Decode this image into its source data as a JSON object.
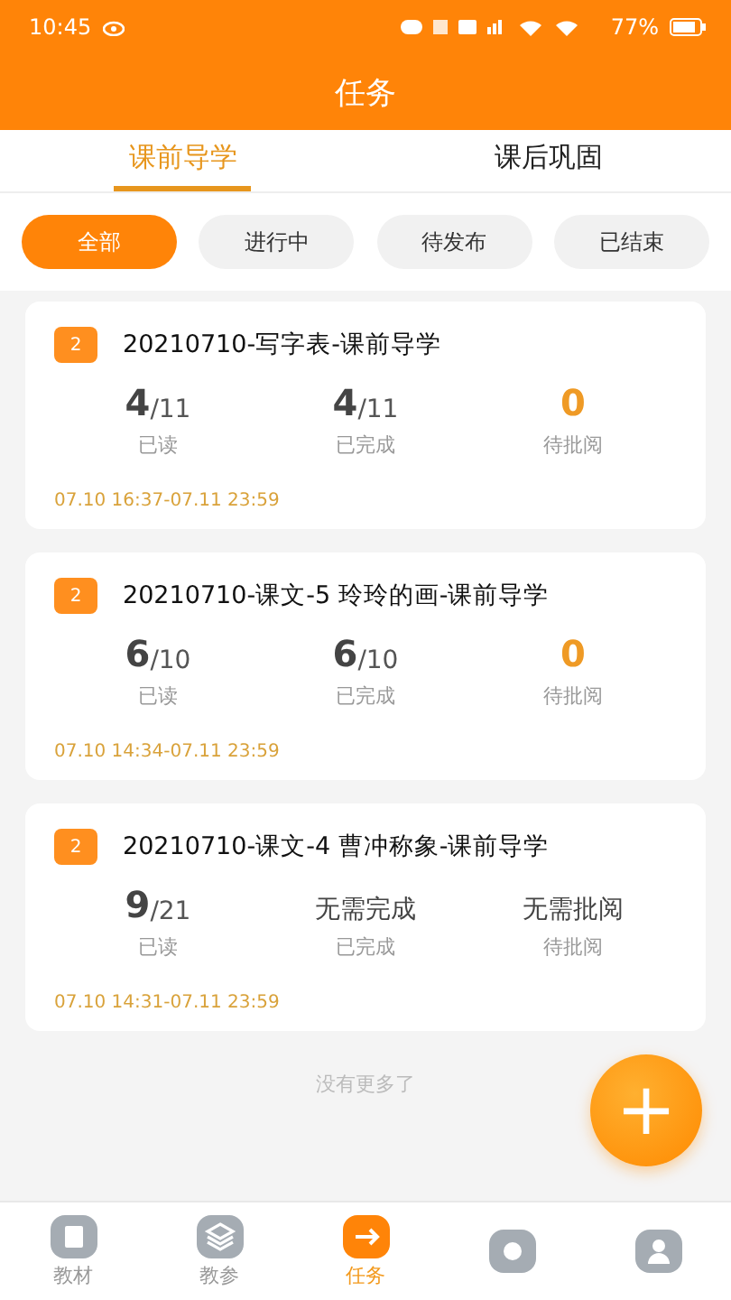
{
  "status_bar": {
    "time": "10:45",
    "battery": "77%"
  },
  "header": {
    "title": "任务"
  },
  "tabs": [
    {
      "label": "课前导学",
      "selected": true
    },
    {
      "label": "课后巩固",
      "selected": false
    }
  ],
  "filters": [
    {
      "label": "全部",
      "selected": true
    },
    {
      "label": "进行中",
      "selected": false
    },
    {
      "label": "待发布",
      "selected": false
    },
    {
      "label": "已结束",
      "selected": false
    }
  ],
  "tasks": [
    {
      "badge": "2",
      "title": "20210710-写字表-课前导学",
      "stats": [
        {
          "kind": "count",
          "value": "**4**/11",
          "label": "已读"
        },
        {
          "kind": "count",
          "value": "**4**/11",
          "label": "已完成"
        },
        {
          "kind": "pending",
          "value": "0",
          "label": "待批阅"
        }
      ],
      "time": "07.10  16:37-07.11  23:59"
    },
    {
      "badge": "2",
      "title": "20210710-课文-5  玲玲的画-课前导学",
      "stats": [
        {
          "kind": "count",
          "value": "**6**/10",
          "label": "已读"
        },
        {
          "kind": "count",
          "value": "**6**/10",
          "label": "已完成"
        },
        {
          "kind": "pending",
          "value": "0",
          "label": "待批阅"
        }
      ],
      "time": "07.10  14:34-07.11  23:59"
    },
    {
      "badge": "2",
      "title": "20210710-课文-4  曹冲称象-课前导学",
      "stats": [
        {
          "kind": "count",
          "value": "**9**/21",
          "label": "已读"
        },
        {
          "kind": "text",
          "value": "无需完成",
          "label": "已完成"
        },
        {
          "kind": "text",
          "value": "无需批阅",
          "label": "待批阅"
        }
      ],
      "time": "07.10  14:31-07.11  23:59"
    }
  ],
  "footer_note": "没有更多了",
  "add_button": {
    "label": "+"
  },
  "nav": [
    {
      "label": "教材",
      "selected": false
    },
    {
      "label": "教参",
      "selected": false
    },
    {
      "label": "任务",
      "selected": true
    },
    {
      "selected": false
    },
    {
      "selected": false
    }
  ]
}
